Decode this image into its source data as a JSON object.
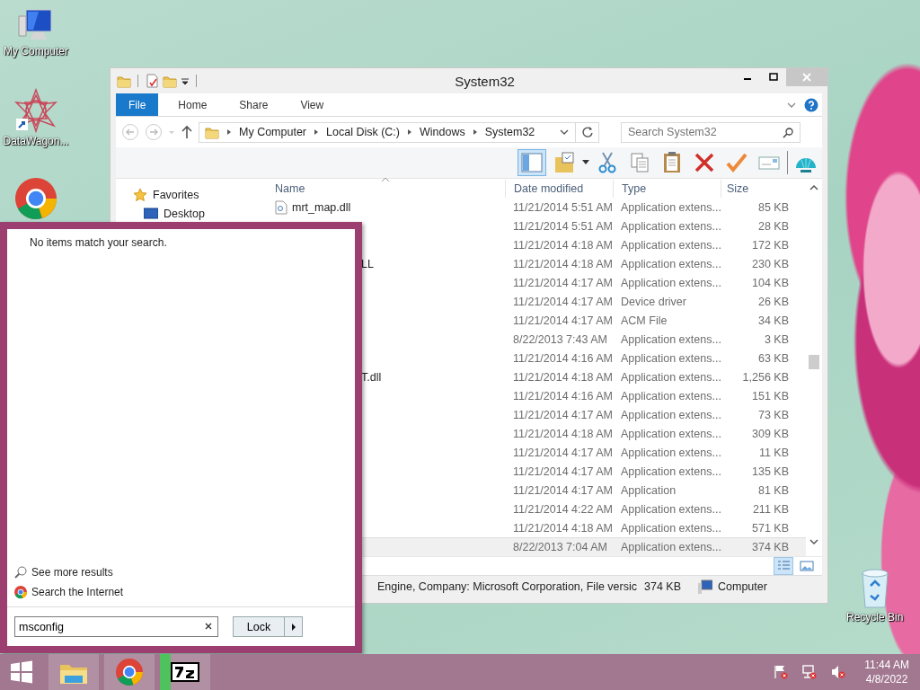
{
  "desktop_icons": [
    {
      "kind": "computer",
      "label": "My Computer"
    },
    {
      "kind": "shortcut",
      "label": "DataWagon..."
    },
    {
      "kind": "chrome"
    }
  ],
  "recycle_bin": {
    "label": "Recycle Bin"
  },
  "explorer": {
    "title": "System32",
    "ribbon_tabs": [
      {
        "label": "File",
        "selected": true
      },
      {
        "label": "Home",
        "selected": false
      },
      {
        "label": "Share",
        "selected": false
      },
      {
        "label": "View",
        "selected": false
      }
    ],
    "address": [
      "My Computer",
      "Local Disk (C:)",
      "Windows",
      "System32"
    ],
    "search": {
      "placeholder": "Search System32"
    },
    "toolbar": [
      {
        "kind": "pane",
        "pressed": true
      },
      {
        "kind": "folder-check"
      },
      {
        "kind": "cut"
      },
      {
        "kind": "copy"
      },
      {
        "kind": "paste"
      },
      {
        "kind": "delete"
      },
      {
        "kind": "check"
      },
      {
        "kind": "card"
      },
      {
        "kind": "shell"
      }
    ],
    "nav": [
      {
        "kind": "favorites",
        "label": "Favorites"
      },
      {
        "kind": "desktop",
        "label": "Desktop"
      }
    ],
    "columns": [
      "Name",
      "Date modified",
      "Type",
      "Size"
    ],
    "rows": [
      {
        "name": "mrt_map.dll",
        "date": "11/21/2014 5:51 AM",
        "type": "Application extens...",
        "size": "85 KB",
        "selected": false
      },
      {
        "date": "11/21/2014 5:51 AM",
        "type": "Application extens...",
        "size": "28 KB",
        "selected": false
      },
      {
        "date": "11/21/2014 4:18 AM",
        "type": "Application extens...",
        "size": "172 KB",
        "selected": false
      },
      {
        "name": "LL",
        "cut": true,
        "date": "11/21/2014 4:18 AM",
        "type": "Application extens...",
        "size": "230 KB",
        "selected": false
      },
      {
        "date": "11/21/2014 4:17 AM",
        "type": "Application extens...",
        "size": "104 KB",
        "selected": false
      },
      {
        "date": "11/21/2014 4:17 AM",
        "type": "Device driver",
        "size": "26 KB",
        "selected": false
      },
      {
        "date": "11/21/2014 4:17 AM",
        "type": "ACM File",
        "size": "34 KB",
        "selected": false
      },
      {
        "date": "8/22/2013 7:43 AM",
        "type": "Application extens...",
        "size": "3 KB",
        "selected": false
      },
      {
        "date": "11/21/2014 4:16 AM",
        "type": "Application extens...",
        "size": "63 KB",
        "selected": false
      },
      {
        "name": "T.dll",
        "cut": true,
        "date": "11/21/2014 4:18 AM",
        "type": "Application extens...",
        "size": "1,256 KB",
        "selected": false
      },
      {
        "date": "11/21/2014 4:16 AM",
        "type": "Application extens...",
        "size": "151 KB",
        "selected": false
      },
      {
        "date": "11/21/2014 4:17 AM",
        "type": "Application extens...",
        "size": "73 KB",
        "selected": false
      },
      {
        "date": "11/21/2014 4:18 AM",
        "type": "Application extens...",
        "size": "309 KB",
        "selected": false
      },
      {
        "date": "11/21/2014 4:17 AM",
        "type": "Application extens...",
        "size": "11 KB",
        "selected": false
      },
      {
        "date": "11/21/2014 4:17 AM",
        "type": "Application extens...",
        "size": "135 KB",
        "selected": false
      },
      {
        "date": "11/21/2014 4:17 AM",
        "type": "Application",
        "size": "81 KB",
        "selected": false
      },
      {
        "date": "11/21/2014 4:22 AM",
        "type": "Application extens...",
        "size": "211 KB",
        "selected": false
      },
      {
        "date": "11/21/2014 4:18 AM",
        "type": "Application extens...",
        "size": "571 KB",
        "selected": false
      },
      {
        "date": "8/22/2013 7:04 AM",
        "type": "Application extens...",
        "size": "374 KB",
        "selected": true
      }
    ],
    "status": {
      "details": "Engine, Company: Microsoft Corporation, File versic",
      "size": "374 KB",
      "location": "Computer"
    }
  },
  "start_menu": {
    "message": "No items match your search.",
    "links": [
      {
        "kind": "search",
        "label": "See more results"
      },
      {
        "kind": "chrome",
        "label": "Search the Internet"
      }
    ],
    "search": {
      "value": "msconfig"
    },
    "power_button": {
      "label": "Lock"
    }
  },
  "taskbar": {
    "buttons": [
      {
        "kind": "explorer"
      },
      {
        "kind": "chrome"
      },
      {
        "kind": "archive"
      }
    ],
    "tray": [
      {
        "kind": "flag"
      },
      {
        "kind": "network"
      },
      {
        "kind": "speaker"
      }
    ],
    "clock": {
      "time": "11:44 AM",
      "date": "4/8/2022"
    }
  }
}
